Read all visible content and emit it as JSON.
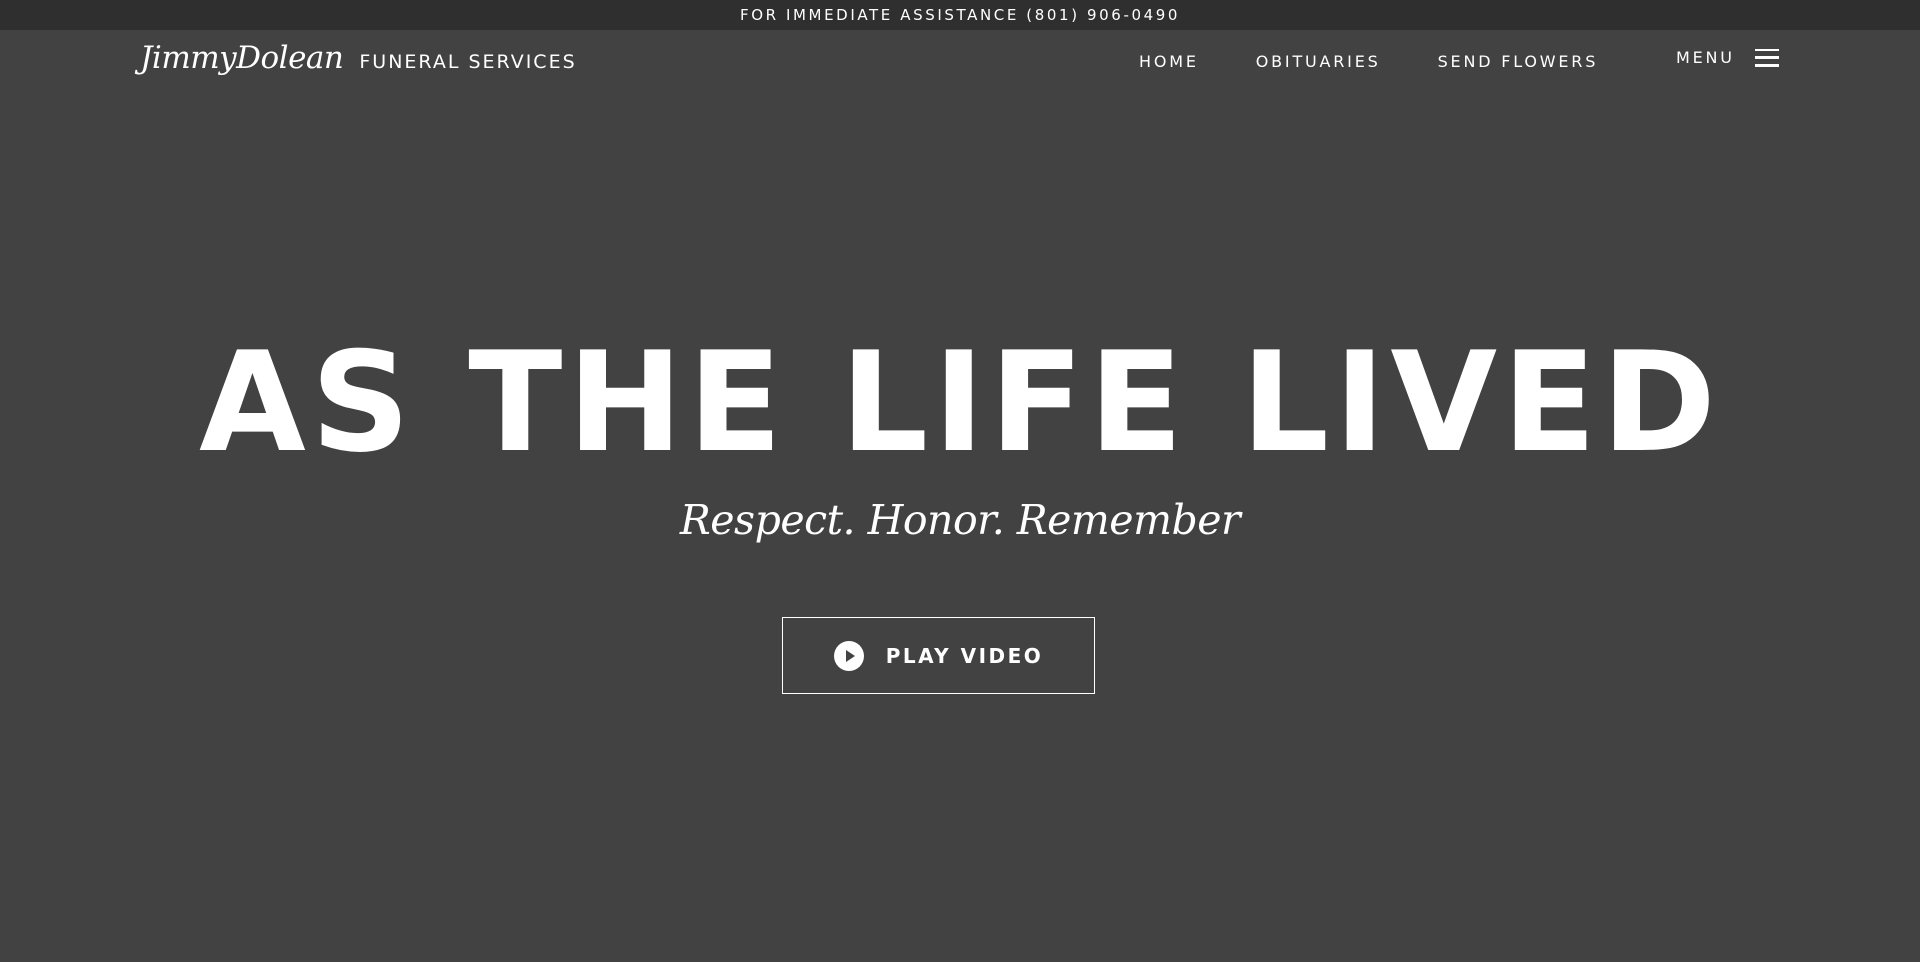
{
  "topbar": {
    "text": "FOR IMMEDIATE ASSISTANCE (801) 906-0490"
  },
  "header": {
    "logo_script": "JimmyDolean",
    "logo_sub": "FUNERAL SERVICES",
    "nav": [
      {
        "label": "HOME"
      },
      {
        "label": "OBITUARIES"
      },
      {
        "label": "SEND FLOWERS"
      }
    ],
    "menu_label": "MENU",
    "menu_icon": "hamburger-menu-icon"
  },
  "hero": {
    "title": "AS THE LIFE LIVED",
    "subtitle": "Respect. Honor. Remember",
    "play_button_label": "PLAY VIDEO",
    "play_icon": "play-circle-icon"
  },
  "colors": {
    "background": "#424242",
    "topbar_background": "#2f2f2f",
    "text": "#ffffff"
  }
}
